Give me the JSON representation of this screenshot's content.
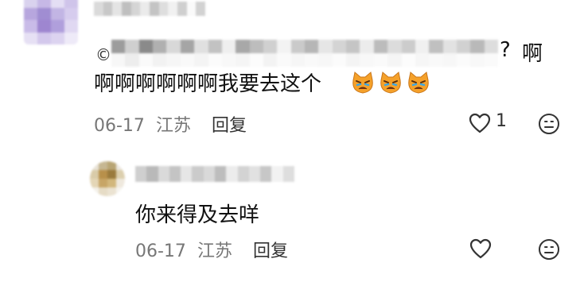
{
  "comment": {
    "avatar_name": "blurred-avatar",
    "username_blurred": true,
    "quote_blurred": true,
    "quote_mark": "?",
    "text_line1": "啊",
    "text_line2": "啊啊啊啊啊啊我要去这个",
    "emojis": [
      "crying-cat-emoji",
      "crying-cat-emoji",
      "crying-cat-emoji"
    ],
    "date": "06-17",
    "location": "江苏",
    "reply_label": "回复",
    "like_count": "1"
  },
  "reply": {
    "avatar_name": "blurred-avatar",
    "username_blurred": true,
    "text": "你来得及去咩",
    "date": "06-17",
    "location": "江苏",
    "reply_label": "回复"
  },
  "colors": {
    "meta": "#777777",
    "text": "#111111",
    "emoji_face": "#f5a12a"
  }
}
